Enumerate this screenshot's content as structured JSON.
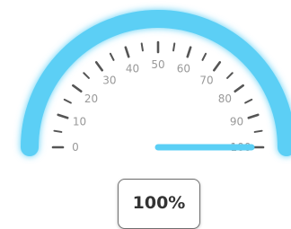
{
  "gauge": {
    "value_percent": 100,
    "scale_min": 0,
    "scale_max": 100,
    "tick_labels": [
      "0",
      "10",
      "20",
      "30",
      "40",
      "50",
      "60",
      "70",
      "80",
      "90",
      "100"
    ],
    "readout": "100%",
    "colors": {
      "arc": "#5bcff5",
      "needle": "#5bcff5",
      "ticks": "#555555",
      "labels": "#999999",
      "readout_text": "#333333"
    }
  }
}
